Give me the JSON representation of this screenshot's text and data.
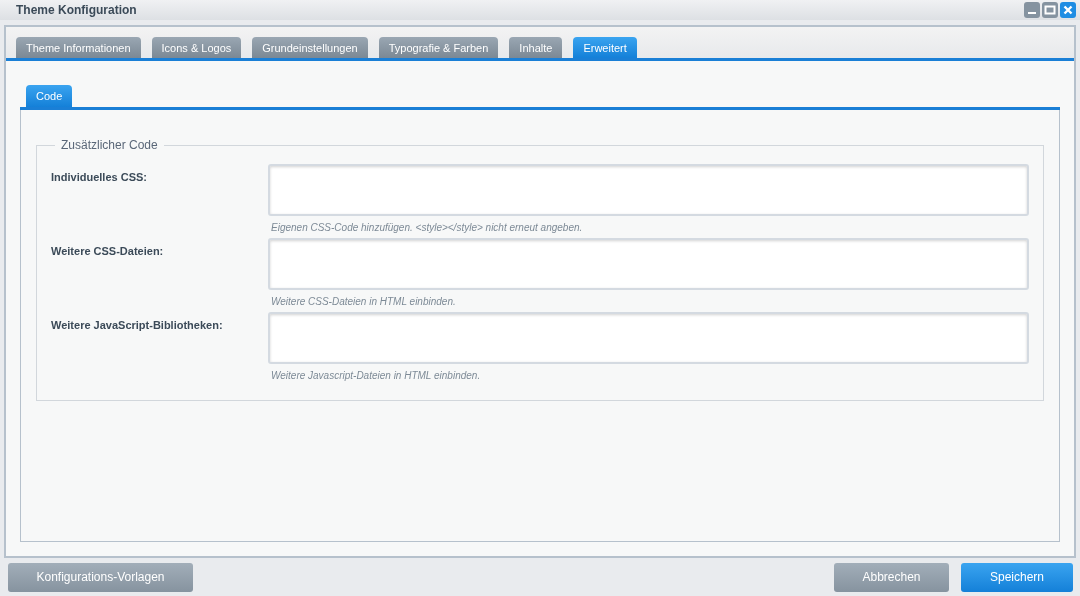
{
  "window": {
    "title": "Theme Konfiguration"
  },
  "tabs": [
    {
      "label": "Theme Informationen",
      "selected": false
    },
    {
      "label": "Icons & Logos",
      "selected": false
    },
    {
      "label": "Grundeinstellungen",
      "selected": false
    },
    {
      "label": "Typografie & Farben",
      "selected": false
    },
    {
      "label": "Inhalte",
      "selected": false
    },
    {
      "label": "Erweitert",
      "selected": true
    }
  ],
  "subtabs": [
    {
      "label": "Code",
      "selected": true
    }
  ],
  "fieldset": {
    "legend": "Zusätzlicher Code",
    "fields": [
      {
        "label": "Individuelles CSS:",
        "hint": "Eigenen CSS-Code hinzufügen. <style></style> nicht erneut angeben."
      },
      {
        "label": "Weitere CSS-Dateien:",
        "hint": "Weitere CSS-Dateien in HTML einbinden."
      },
      {
        "label": "Weitere JavaScript-Bibliotheken:",
        "hint": "Weitere Javascript-Dateien in HTML einbinden."
      }
    ]
  },
  "footer": {
    "buttons": [
      {
        "label": "Konfigurations-Vorlagen",
        "kind": "secondary"
      },
      {
        "label": "Abbrechen",
        "kind": "secondary"
      },
      {
        "label": "Speichern",
        "kind": "primary"
      }
    ]
  }
}
